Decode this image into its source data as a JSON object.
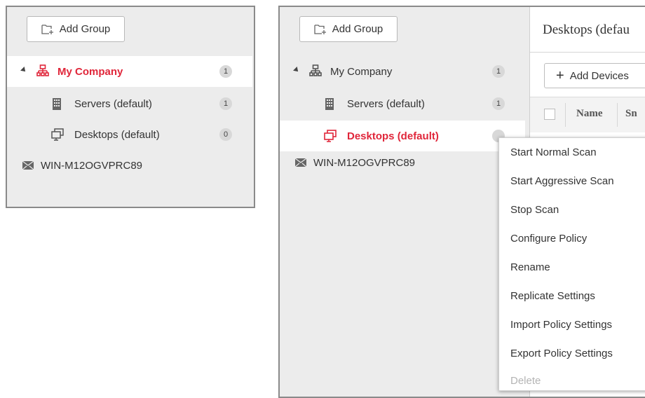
{
  "add_group_label": "Add Group",
  "panel_left": {
    "tree": [
      {
        "label": "My Company",
        "count": "1"
      },
      {
        "label": "Servers (default)",
        "count": "1"
      },
      {
        "label": "Desktops (default)",
        "count": "0"
      },
      {
        "label": "WIN-M12OGVPRC89"
      }
    ]
  },
  "panel_right": {
    "tree": [
      {
        "label": "My Company",
        "count": "1"
      },
      {
        "label": "Servers (default)",
        "count": "1"
      },
      {
        "label": "Desktops (default)"
      },
      {
        "label": "WIN-M12OGVPRC89"
      }
    ],
    "content_title": "Desktops (defau",
    "add_devices_label": "Add Devices",
    "columns": [
      "Name",
      "Sn"
    ]
  },
  "context_menu": {
    "items": [
      "Start Normal Scan",
      "Start Aggressive Scan",
      "Stop Scan",
      "Configure Policy",
      "Rename",
      "Replicate Settings",
      "Import Policy Settings",
      "Export Policy Settings",
      "Delete"
    ],
    "disabled_item": "Delete"
  },
  "colors": {
    "accent_red": "#e0263a",
    "panel_bg": "#ececec",
    "badge_bg": "#d8d8d8"
  },
  "icons": {
    "add_group": "add-folder-icon",
    "company": "network-tree-icon",
    "servers": "server-icon",
    "desktops": "desktop-icon",
    "unassigned": "envelope-icon"
  }
}
